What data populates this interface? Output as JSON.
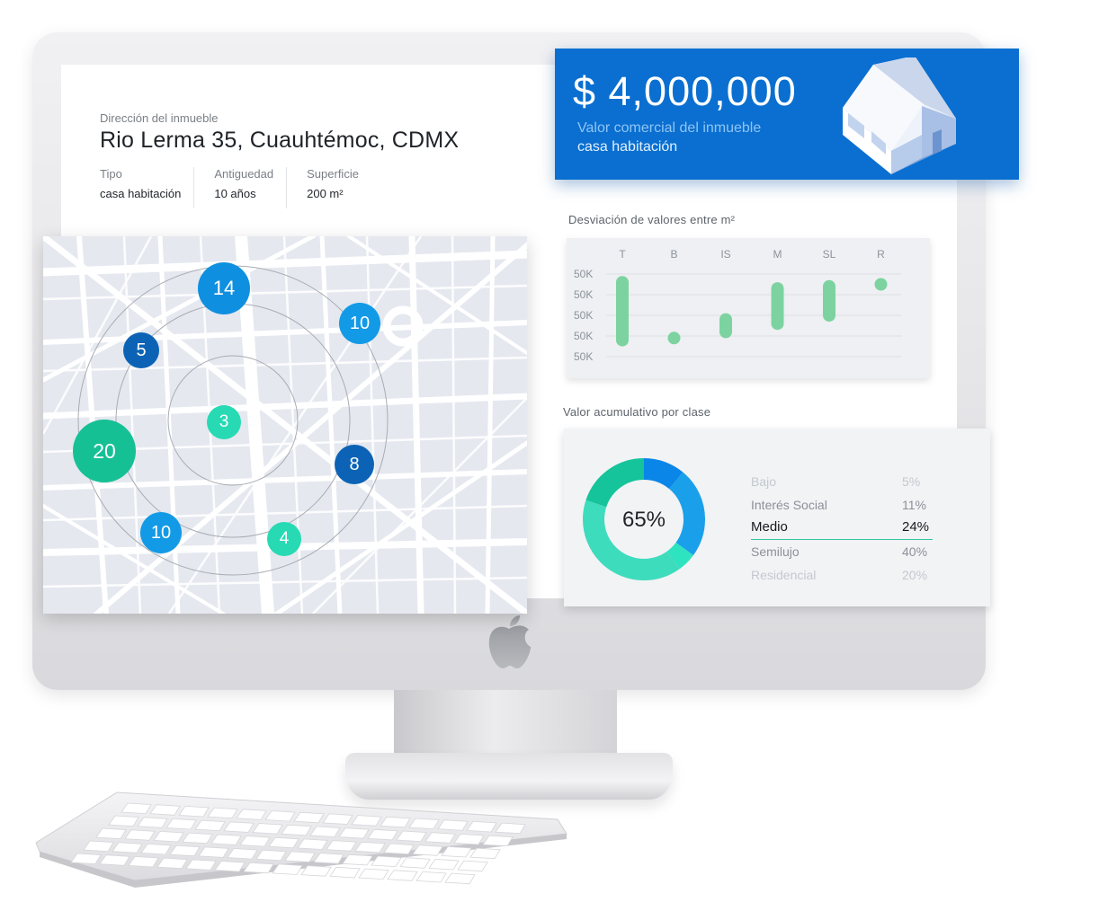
{
  "property": {
    "address_label": "Dirección del inmueble",
    "address": "Rio Lerma 35, Cuauhtémoc, CDMX",
    "attributes": [
      {
        "label": "Tipo",
        "value": "casa habitación"
      },
      {
        "label": "Antiguedad",
        "value": "10 años"
      },
      {
        "label": "Superficie",
        "value": "200 m²"
      }
    ]
  },
  "price_card": {
    "amount": "$ 4,000,000",
    "label": "Valor comercial del inmueble",
    "subtitle": "casa habitación",
    "icon": "house-icon",
    "bg_color": "#0a6fd0"
  },
  "deviation_chart": {
    "title": "Desviación de valores entre m²"
  },
  "accumulated_chart": {
    "title": "Valor acumulativo por clase",
    "center_label": "65%"
  },
  "map": {
    "bubbles": [
      {
        "value": "14",
        "color": "#0f8fe0"
      },
      {
        "value": "10",
        "color": "#139ae6"
      },
      {
        "value": "5",
        "color": "#0c63b6"
      },
      {
        "value": "3",
        "color": "#27dab4"
      },
      {
        "value": "20",
        "color": "#16c095"
      },
      {
        "value": "8",
        "color": "#0c63b6"
      },
      {
        "value": "10",
        "color": "#139ae6"
      },
      {
        "value": "4",
        "color": "#27dab4"
      }
    ]
  },
  "chart_data": [
    {
      "type": "scatter",
      "title": "Desviación de valores entre m²",
      "categories": [
        "T",
        "B",
        "IS",
        "M",
        "SL",
        "R"
      ],
      "y_tick_labels": [
        "50K",
        "50K",
        "50K",
        "50K",
        "50K"
      ],
      "ranges": [
        {
          "category": "T",
          "low": 0.8,
          "high": 3.6
        },
        {
          "category": "B",
          "low": 0.9,
          "high": 0.9
        },
        {
          "category": "IS",
          "low": 1.2,
          "high": 1.8
        },
        {
          "category": "M",
          "low": 1.6,
          "high": 3.3
        },
        {
          "category": "SL",
          "low": 2.0,
          "high": 3.4
        },
        {
          "category": "R",
          "low": 3.5,
          "high": 3.5
        }
      ],
      "ylim": [
        0,
        4
      ],
      "grid": true,
      "mark_color": "#7dd3a0"
    },
    {
      "type": "pie",
      "title": "Valor acumulativo por clase",
      "center_value": "65%",
      "slices": [
        {
          "label": "Bajo",
          "value": 5,
          "display": "5%",
          "color": "#2ee3c0"
        },
        {
          "label": "Interés Social",
          "value": 11,
          "display": "11%",
          "color": "#0a86e8"
        },
        {
          "label": "Medio",
          "value": 24,
          "display": "24%",
          "color": "#1aa0ea"
        },
        {
          "label": "Semilujo",
          "value": 40,
          "display": "40%",
          "color": "#3ddcbc"
        },
        {
          "label": "Residencial",
          "value": 20,
          "display": "20%",
          "color": "#15c49a"
        }
      ]
    }
  ]
}
